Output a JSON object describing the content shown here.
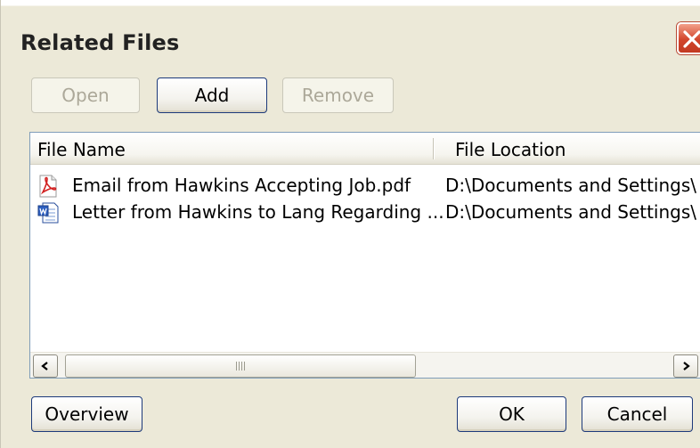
{
  "window": {
    "title": "Related Files",
    "close_icon": "close-icon"
  },
  "toolbar": {
    "open_label": "Open",
    "add_label": "Add",
    "remove_label": "Remove"
  },
  "list": {
    "columns": [
      "File Name",
      "File Location"
    ],
    "rows": [
      {
        "icon": "pdf-file-icon",
        "name": "Email from Hawkins Accepting Job.pdf",
        "location": "D:\\Documents and Settings\\"
      },
      {
        "icon": "word-document-icon",
        "name": "Letter from Hawkins to Lang Regarding ...",
        "location": "D:\\Documents and Settings\\"
      }
    ]
  },
  "footer": {
    "overview_label": "Overview",
    "ok_label": "OK",
    "cancel_label": "Cancel"
  },
  "colors": {
    "dialog_bg": "#ece9d8",
    "close_red": "#d2452c",
    "button_border": "#1d3a7b",
    "list_border": "#7f9db9"
  }
}
